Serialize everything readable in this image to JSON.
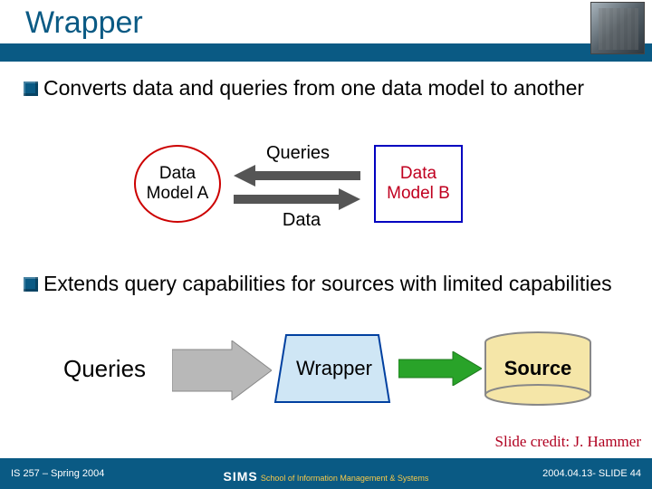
{
  "title": "Wrapper",
  "bullets": {
    "b1": "Converts data and queries from one data model to another",
    "b2": "Extends query capabilities for sources with limited capabilities"
  },
  "diagram1": {
    "nodeA": "Data Model A",
    "nodeB": "Data Model B",
    "edgeTop": "Queries",
    "edgeBottom": "Data"
  },
  "diagram2": {
    "input": "Queries",
    "middle": "Wrapper",
    "right": "Source"
  },
  "credit": "Slide credit: J. Hammer",
  "footer": {
    "left": "IS 257 – Spring 2004",
    "center_brand": "SIMS",
    "center_sub": "School of Information Management & Systems",
    "right": "2004.04.13- SLIDE 44"
  }
}
